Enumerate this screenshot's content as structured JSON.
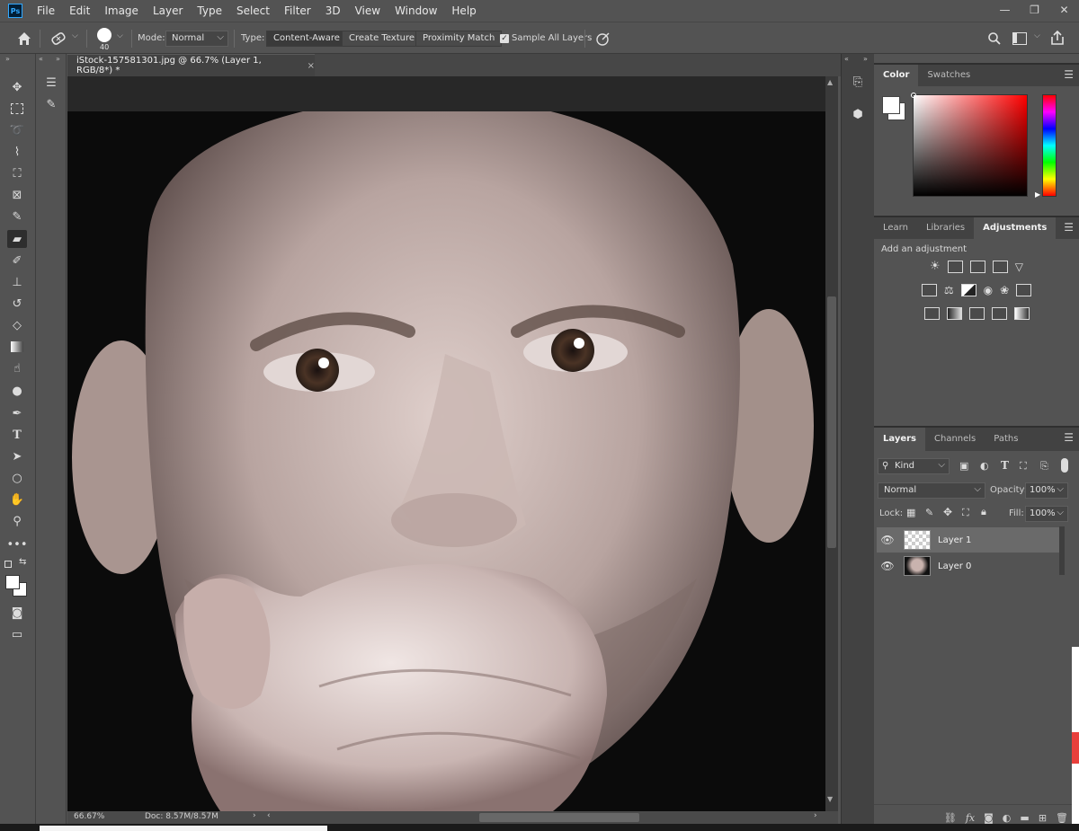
{
  "app": {
    "logo": "Ps"
  },
  "menu": [
    "File",
    "Edit",
    "Image",
    "Layer",
    "Type",
    "Select",
    "Filter",
    "3D",
    "View",
    "Window",
    "Help"
  ],
  "window_controls": [
    "—",
    "❐",
    "✕"
  ],
  "options": {
    "brush_size": "40",
    "mode_label": "Mode:",
    "mode_value": "Normal",
    "type_label": "Type:",
    "type_buttons": [
      "Content-Aware",
      "Create Texture",
      "Proximity Match"
    ],
    "sample_all_label": "Sample All Layers",
    "sample_all_checked": true
  },
  "document": {
    "tab_title": "iStock-157581301.jpg @ 66.7% (Layer 1, RGB/8*) *",
    "close": "×",
    "zoom": "66.67%",
    "doc_info": "Doc: 8.57M/8.57M"
  },
  "tools": [
    "move-icon",
    "marquee-icon",
    "lasso-icon",
    "quick-select-icon",
    "crop-icon",
    "frame-icon",
    "eyedropper-icon",
    "healing-brush-icon",
    "brush-icon",
    "clone-stamp-icon",
    "history-brush-icon",
    "eraser-icon",
    "gradient-icon",
    "blur-icon",
    "dodge-icon",
    "pen-icon",
    "type-icon",
    "path-select-icon",
    "ellipse-icon",
    "hand-icon",
    "zoom-icon",
    "more-icon"
  ],
  "color_panel": {
    "tabs": [
      "Color",
      "Swatches"
    ],
    "active_tab": "Color",
    "hue_color": "#ff0000"
  },
  "adjust_panel": {
    "tabs": [
      "Learn",
      "Libraries",
      "Adjustments"
    ],
    "active_tab": "Adjustments",
    "subtitle": "Add an adjustment"
  },
  "layers_panel": {
    "tabs": [
      "Layers",
      "Channels",
      "Paths"
    ],
    "active_tab": "Layers",
    "filter_kind": "Kind",
    "blend_mode": "Normal",
    "opacity_label": "Opacity:",
    "opacity": "100%",
    "lock_label": "Lock:",
    "fill_label": "Fill:",
    "fill": "100%",
    "layers": [
      {
        "name": "Layer 1",
        "selected": true,
        "thumb": "transparent"
      },
      {
        "name": "Layer 0",
        "selected": false,
        "thumb": "photo"
      }
    ]
  }
}
